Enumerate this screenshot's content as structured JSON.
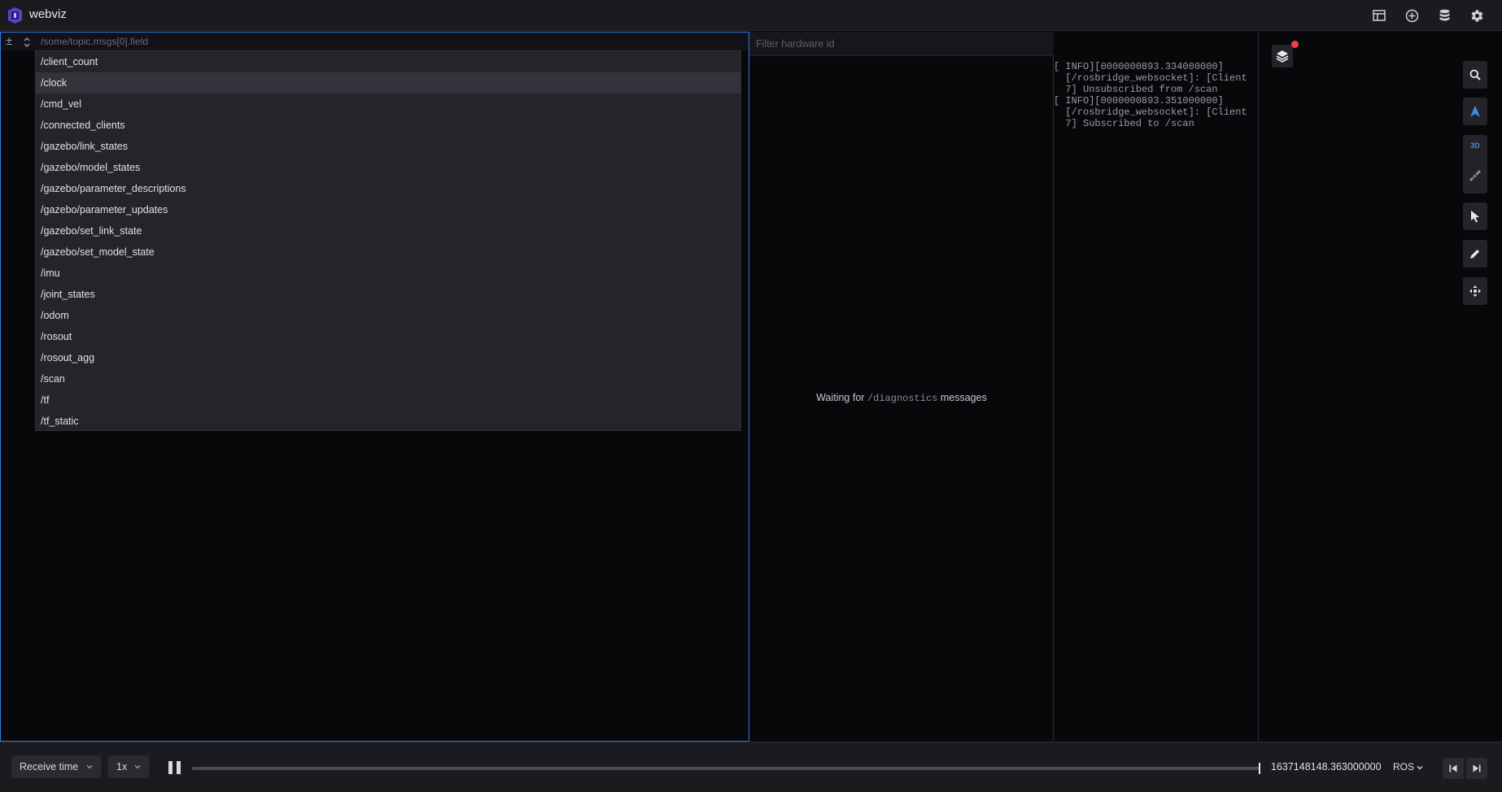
{
  "app": {
    "title": "webviz"
  },
  "colors": {
    "accent": "#2d7be5",
    "highlight_blue": "#3d8ef0",
    "alert_red": "#f03e4f"
  },
  "topbar_icons": [
    "layout-icon",
    "add-panel-icon",
    "data-source-icon",
    "settings-icon"
  ],
  "plot": {
    "path_placeholder": "/some/topic.msgs[0].field",
    "topics": [
      "/client_count",
      "/clock",
      "/cmd_vel",
      "/connected_clients",
      "/gazebo/link_states",
      "/gazebo/model_states",
      "/gazebo/parameter_descriptions",
      "/gazebo/parameter_updates",
      "/gazebo/set_link_state",
      "/gazebo/set_model_state",
      "/imu",
      "/joint_states",
      "/odom",
      "/rosout",
      "/rosout_agg",
      "/scan",
      "/tf",
      "/tf_static"
    ],
    "highlighted_topic": "/clock"
  },
  "diagnostics": {
    "filter_placeholder": "Filter hardware id",
    "waiting_prefix": "Waiting for",
    "waiting_topic": "/diagnostics",
    "waiting_suffix": "messages"
  },
  "rosout": {
    "lines": [
      "[ INFO][0000000893.334000000]",
      "  [/rosbridge_websocket]: [Client",
      "  7] Unsubscribed from /scan",
      "[ INFO][0000000893.351000000]",
      "  [/rosbridge_websocket]: [Client",
      "  7] Subscribed to /scan"
    ]
  },
  "viz3d": {
    "mode_label": "3D"
  },
  "playback": {
    "time_mode": "Receive time",
    "speed": "1x",
    "timestamp": "1637148148.363000000",
    "time_format": "ROS",
    "progress": 1.0
  }
}
